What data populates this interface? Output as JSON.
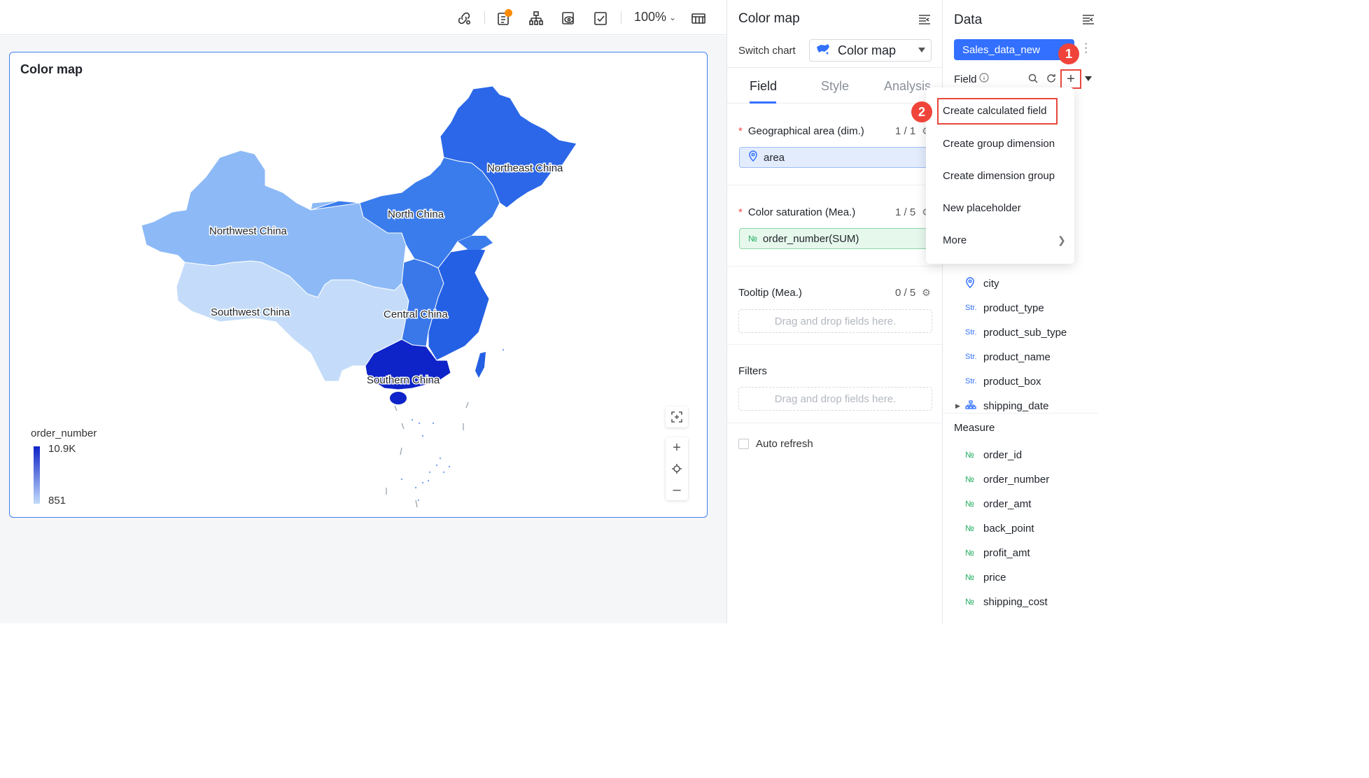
{
  "toolbar": {
    "zoom": "100%",
    "icons": [
      "link-settings-icon",
      "report-icon",
      "org-chart-icon",
      "preview-icon",
      "checklist-icon",
      "table-layout-icon"
    ],
    "notification_color": "#ff8a00"
  },
  "chart": {
    "title": "Color map",
    "regions": [
      {
        "name": "Northeast China"
      },
      {
        "name": "North China"
      },
      {
        "name": "Northwest China"
      },
      {
        "name": "Southwest China"
      },
      {
        "name": "Central China"
      },
      {
        "name": "Southern China"
      }
    ],
    "legend": {
      "title": "order_number",
      "max_label": "10.9K",
      "min_label": "851",
      "color_max": "#0e23c8",
      "color_min": "#c2dbfa"
    }
  },
  "config": {
    "title": "Color map",
    "switch_label": "Switch chart",
    "switch_value": "Color map",
    "tabs": [
      "Field",
      "Style",
      "Analysis"
    ],
    "active_tab": "Field",
    "geo": {
      "label": "Geographical area (dim.)",
      "count": "1 / 1",
      "value": "area"
    },
    "saturation": {
      "label": "Color saturation (Mea.)",
      "count": "1 / 5",
      "value": "order_number(SUM)"
    },
    "tooltip": {
      "label": "Tooltip (Mea.)",
      "count": "0 / 5",
      "placeholder": "Drag and drop fields here."
    },
    "filters": {
      "label": "Filters",
      "placeholder": "Drag and drop fields here."
    },
    "auto_refresh": "Auto refresh"
  },
  "data_panel": {
    "title": "Data",
    "dataset": "Sales_data_new",
    "field_label": "Field",
    "dimension_fields": [
      {
        "type": "geo",
        "name": "city"
      },
      {
        "type": "Str.",
        "name": "product_type"
      },
      {
        "type": "Str.",
        "name": "product_sub_type"
      },
      {
        "type": "Str.",
        "name": "product_name"
      },
      {
        "type": "Str.",
        "name": "product_box"
      },
      {
        "type": "hier",
        "name": "shipping_date"
      }
    ],
    "measure_header": "Measure",
    "measure_fields": [
      {
        "type": "№",
        "name": "order_id"
      },
      {
        "type": "№",
        "name": "order_number"
      },
      {
        "type": "№",
        "name": "order_amt"
      },
      {
        "type": "№",
        "name": "back_point"
      },
      {
        "type": "№",
        "name": "profit_amt"
      },
      {
        "type": "№",
        "name": "price"
      },
      {
        "type": "№",
        "name": "shipping_cost"
      }
    ]
  },
  "add_menu": {
    "items": [
      "Create calculated field",
      "Create group dimension",
      "Create dimension group",
      "New placeholder",
      "More"
    ]
  },
  "badges": {
    "step1": "1",
    "step2": "2"
  }
}
